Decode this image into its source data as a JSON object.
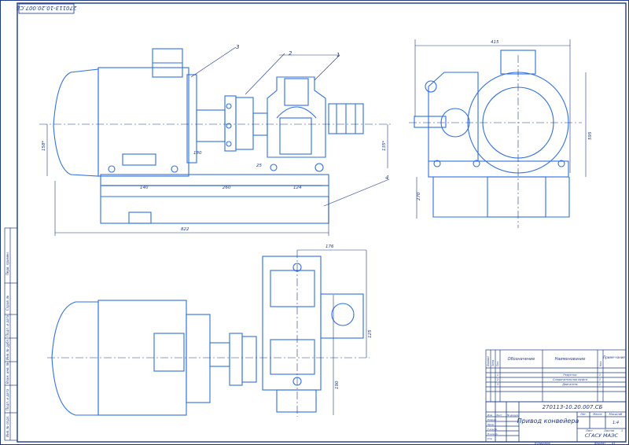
{
  "sheet": {
    "rotated_code": "270113-10.20.007.СБ"
  },
  "dimensions": {
    "width_top": "415",
    "height_right": "595",
    "height_low": "270",
    "overall": "822",
    "d140": "140",
    "d260": "260",
    "d124": "124",
    "d25": "25",
    "d180": "180",
    "d158": "158*",
    "d135": "135*",
    "d176": "176",
    "d125": "125",
    "d190": "190"
  },
  "callouts": [
    "1",
    "2",
    "3",
    "4"
  ],
  "bom": {
    "headers": {
      "format": "Формат",
      "zone": "Зона",
      "pos": "Поз.",
      "designation": "Обозначение",
      "name": "Наименование",
      "qty": "Кол.",
      "note": "Приме-чание"
    },
    "rows": [
      {
        "pos": "1",
        "name": "Редуктор",
        "qty": "1"
      },
      {
        "pos": "2",
        "name": "Соединительная муфта",
        "qty": "1"
      },
      {
        "pos": "3",
        "name": "Двигатель",
        "qty": "1"
      }
    ]
  },
  "title_block": {
    "code": "270113-10.20.007.СБ",
    "title": "Привод конвейера",
    "org": "СГАСУ МАЭС",
    "lit": "Лит.",
    "mass": "Масса",
    "scale": "Масштаб",
    "scale_value": "1:4",
    "sheet": "Лист",
    "sheets": "Листов",
    "sheets_value": "1",
    "row_labels": [
      "Изм",
      "Лист",
      "№ докум.",
      "Подп.",
      "Дата"
    ],
    "people": [
      "Разраб.",
      "Пров.",
      "Т.контр.",
      "Н.контр.",
      "Утв."
    ],
    "copied": "Копировал",
    "format": "Формат",
    "format_value": "А1"
  },
  "left_strip": [
    "Перв. примен.",
    "Справ. №",
    "Подп. и дата",
    "Инв. № дубл.",
    "Взам. инв. №",
    "Подп. и дата",
    "Инв. № подл."
  ]
}
